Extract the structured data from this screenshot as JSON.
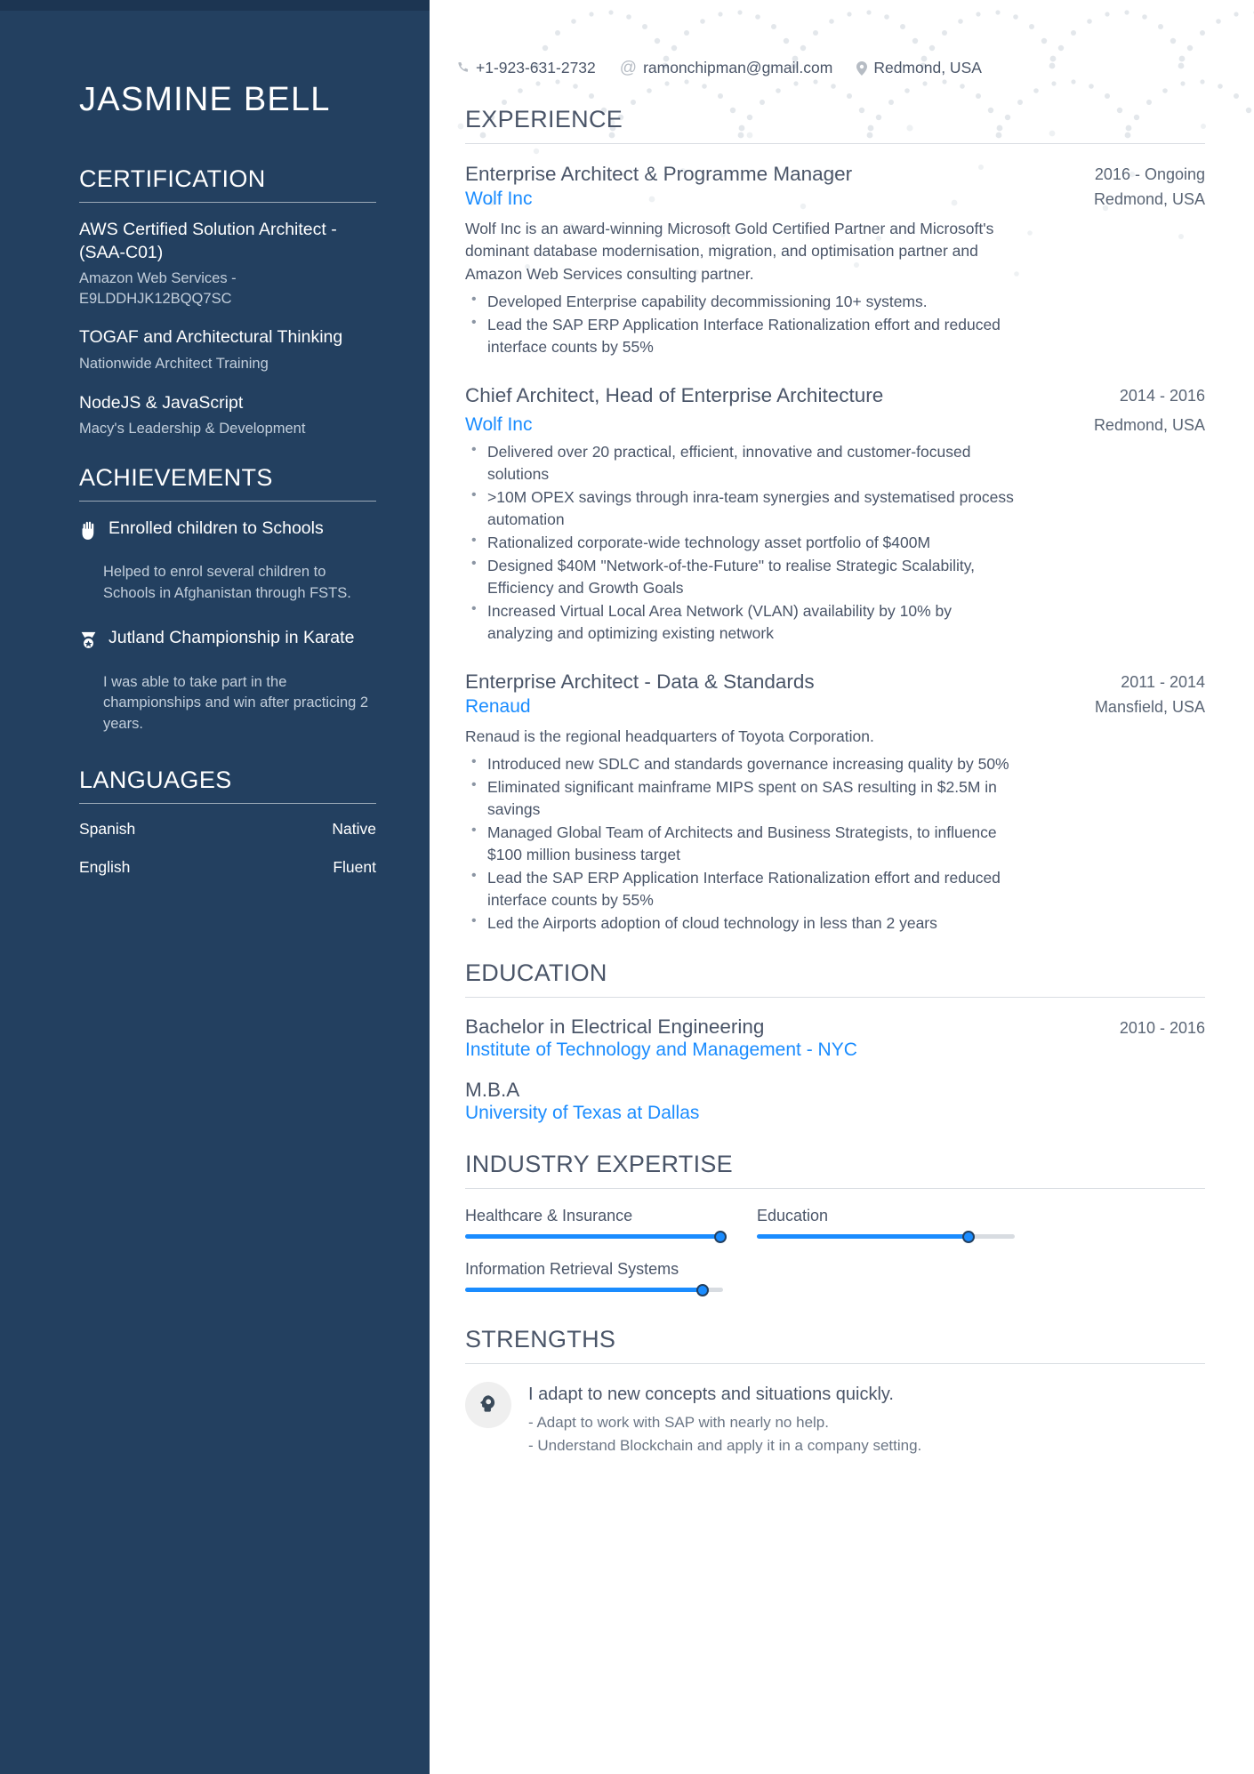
{
  "colors": {
    "sidebar_bg": "#234060",
    "accent_blue": "#1a8cff",
    "text_dark": "#4a5568",
    "muted": "#c2cedb"
  },
  "sidebar": {
    "name": "JASMINE BELL",
    "certification": {
      "heading": "CERTIFICATION",
      "items": [
        {
          "title": "AWS Certified Solution Architect - (SAA-C01)",
          "sub": "Amazon Web Services - E9LDDHJK12BQQ7SC"
        },
        {
          "title": "TOGAF and Architectural Thinking",
          "sub": "Nationwide Architect Training"
        },
        {
          "title": "NodeJS & JavaScript",
          "sub": "Macy's Leadership & Development"
        }
      ]
    },
    "achievements": {
      "heading": "ACHIEVEMENTS",
      "items": [
        {
          "icon": "hand-icon",
          "title": "Enrolled children to Schools",
          "desc": "Helped to enrol several children to Schools in Afghanistan through FSTS."
        },
        {
          "icon": "medal-icon",
          "title": "Jutland Championship in Karate",
          "desc": "I was able to take part in the championships and win after practicing 2 years."
        }
      ]
    },
    "languages": {
      "heading": "LANGUAGES",
      "items": [
        {
          "name": "Spanish",
          "level": "Native"
        },
        {
          "name": "English",
          "level": "Fluent"
        }
      ]
    }
  },
  "contact": {
    "phone": "+1-923-631-2732",
    "email": "ramonchipman@gmail.com",
    "location": "Redmond, USA",
    "phone_icon": "phone-icon",
    "email_icon": "at-icon",
    "location_icon": "map-pin-icon"
  },
  "experience": {
    "heading": "EXPERIENCE",
    "jobs": [
      {
        "title": "Enterprise Architect & Programme Manager",
        "date": "2016 - Ongoing",
        "org": "Wolf Inc",
        "location": "Redmond, USA",
        "desc": "Wolf Inc is an award-winning Microsoft Gold Certified Partner and Microsoft's dominant database modernisation, migration, and optimisation partner and Amazon Web Services consulting partner.",
        "bullets": [
          "Developed Enterprise capability decommissioning 10+ systems.",
          "Lead the SAP ERP Application Interface Rationalization effort and reduced interface counts by 55%"
        ]
      },
      {
        "title": "Chief Architect, Head of Enterprise Architecture",
        "date": "2014 - 2016",
        "org": "Wolf Inc",
        "location": "Redmond, USA",
        "desc": "",
        "bullets": [
          "Delivered over 20 practical, efficient, innovative and customer-focused solutions",
          ">10M OPEX savings through inra-team synergies and systematised process automation",
          "Rationalized corporate-wide technology asset portfolio of $400M",
          "Designed $40M \"Network-of-the-Future\" to realise Strategic Scalability, Efficiency and Growth Goals",
          "Increased Virtual Local Area Network (VLAN) availability by 10% by analyzing and optimizing existing network"
        ]
      },
      {
        "title": "Enterprise Architect - Data & Standards",
        "date": "2011 - 2014",
        "org": "Renaud",
        "location": "Mansfield, USA",
        "desc": "Renaud is the regional headquarters of Toyota Corporation.",
        "bullets": [
          "Introduced new SDLC and standards governance increasing quality by 50%",
          "Eliminated significant mainframe MIPS spent on SAS resulting in $2.5M in savings",
          "Managed Global Team of Architects and Business Strategists, to influence $100 million business target",
          "Lead the SAP ERP Application Interface Rationalization effort and reduced interface counts by 55%",
          "Led the Airports adoption of cloud technology in less than 2 years"
        ]
      }
    ]
  },
  "education": {
    "heading": "EDUCATION",
    "items": [
      {
        "degree": "Bachelor in Electrical Engineering",
        "date": "2010 - 2016",
        "school": "Institute of Technology and Management - NYC"
      },
      {
        "degree": "M.B.A",
        "date": "",
        "school": "University of Texas at Dallas"
      }
    ]
  },
  "industry_expertise": {
    "heading": "INDUSTRY EXPERTISE",
    "items": [
      {
        "label": "Healthcare & Insurance",
        "percent": 99
      },
      {
        "label": "Education",
        "percent": 82
      },
      {
        "label": "Information Retrieval Systems",
        "percent": 92
      }
    ]
  },
  "strengths": {
    "heading": "STRENGTHS",
    "items": [
      {
        "icon": "head-idea-icon",
        "title": "I adapt to new concepts and situations quickly.",
        "line1": "- Adapt to work with SAP with nearly no help.",
        "line2": "- Understand Blockchain and apply it in a company setting."
      }
    ]
  }
}
